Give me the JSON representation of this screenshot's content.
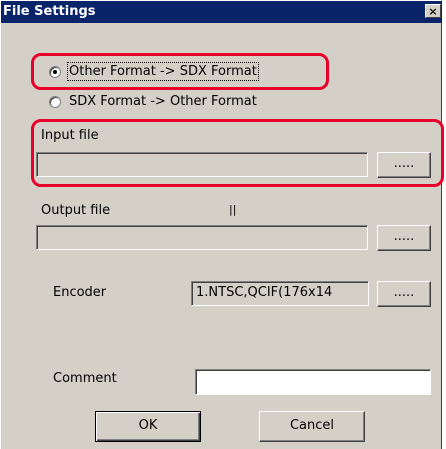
{
  "window": {
    "title": "File Settings",
    "close_glyph": "×"
  },
  "format_options": [
    {
      "label": "Other Format -> SDX Format",
      "selected": true
    },
    {
      "label": "SDX Format -> Other Format",
      "selected": false
    }
  ],
  "input_file": {
    "label": "Input file",
    "value": "",
    "browse_label": "....."
  },
  "output_file": {
    "label": "Output file",
    "value": "",
    "browse_label": "....."
  },
  "marker_text": "||",
  "encoder": {
    "label": "Encoder",
    "value": "1.NTSC,QCIF(176x14",
    "browse_label": "....."
  },
  "comment": {
    "label": "Comment",
    "value": ""
  },
  "buttons": {
    "ok": "OK",
    "cancel": "Cancel"
  },
  "highlight_color": "#e8002a"
}
